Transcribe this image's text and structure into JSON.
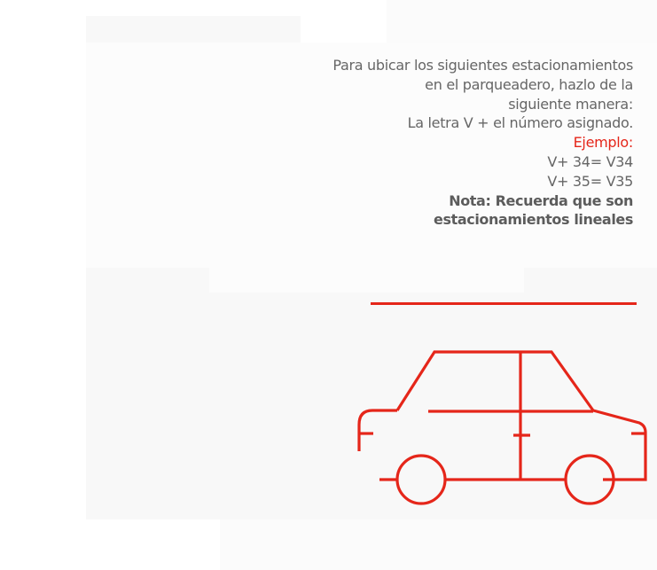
{
  "instructions": {
    "line1": "Para ubicar los siguientes estacionamientos",
    "line2": "en el parqueadero, hazlo de la",
    "line3": "siguiente manera:",
    "line4": "La letra V + el número asignado.",
    "example_label": "Ejemplo:",
    "example1": "V+ 34= V34",
    "example2": "V+ 35= V35",
    "note_line1": "Nota: Recuerda que son",
    "note_line2": "estacionamientos lineales"
  },
  "illustration": {
    "icon": "car-icon",
    "color": "#e5261a"
  }
}
